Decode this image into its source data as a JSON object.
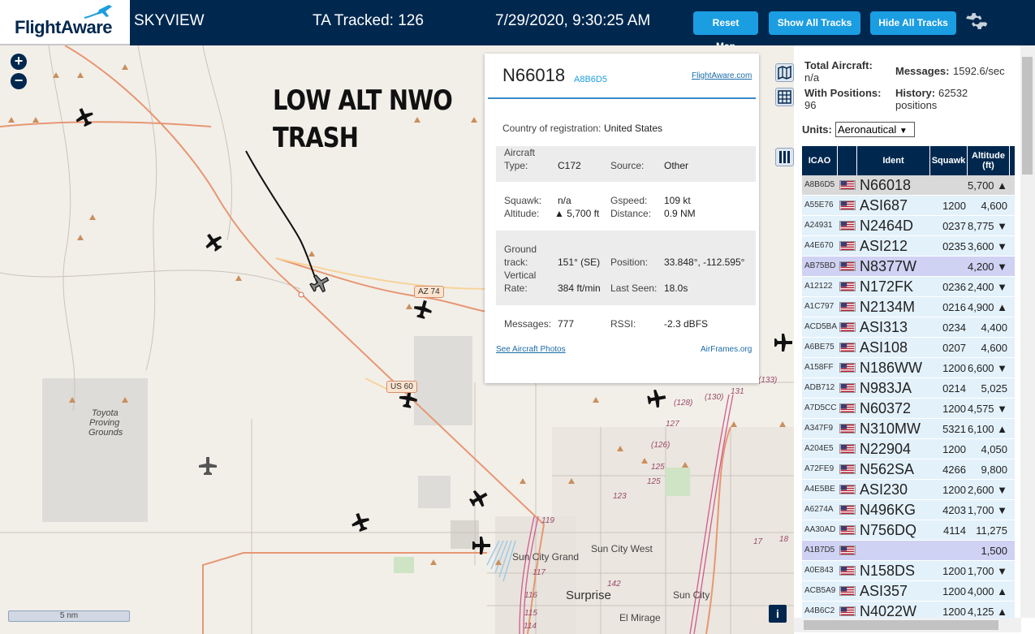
{
  "header": {
    "logo": "FlightAware",
    "title": "SKYVIEW",
    "tracked": "TA Tracked: 126",
    "datetime": "7/29/2020, 9:30:25 AM",
    "reset_label": "Reset Map",
    "show_label": "Show All Tracks",
    "hide_label": "Hide All Tracks",
    "brand_color": "#00284f",
    "button_color": "#1b9de2"
  },
  "map": {
    "zoom_in": "+",
    "zoom_out": "−",
    "annotation_line1": "LOW ALT NWO",
    "annotation_line2": "TRASH",
    "scale": "5 nm",
    "info_btn": "i",
    "labels": [
      {
        "text": "Toyota"
      },
      {
        "text": "Proving"
      },
      {
        "text": "Grounds"
      },
      {
        "text": "Sun City Grand"
      },
      {
        "text": "Sun City West"
      },
      {
        "text": "Surprise"
      },
      {
        "text": "Sun City"
      },
      {
        "text": "El Mirage"
      }
    ],
    "shields": [
      "AZ 74",
      "US 60"
    ],
    "road_numbers": [
      "(128)",
      "(130)",
      "131",
      "127",
      "(126)",
      "125",
      "123",
      "125",
      "119",
      "117",
      "116",
      "115",
      "114",
      "142",
      "(133)",
      "17",
      "18",
      "119"
    ]
  },
  "popup": {
    "ident": "N66018",
    "icao": "A8B6D5",
    "fa_link": "FlightAware.com",
    "country_label": "Country of registration:",
    "country": "United States",
    "type_label_1": "Aircraft",
    "type_label_2": "Type:",
    "type": "C172",
    "source_label": "Source:",
    "source": "Other",
    "squawk_label": "Squawk:",
    "squawk": "n/a",
    "gspeed_label": "Gspeed:",
    "gspeed": "109 kt",
    "altitude_label": "Altitude:",
    "altitude": "▲ 5,700 ft",
    "distance_label": "Distance:",
    "distance": "0.9 NM",
    "track_label_1": "Ground",
    "track_label_2": "track:",
    "track": "151° (SE)",
    "position_label": "Position:",
    "position": "33.848°, -112.595°",
    "vrate_label_1": "Vertical",
    "vrate_label_2": "Rate:",
    "vrate": "384 ft/min",
    "lastseen_label": "Last Seen:",
    "lastseen": "18.0s",
    "messages_label": "Messages:",
    "messages": "777",
    "rssi_label": "RSSI:",
    "rssi": "-2.3 dBFS",
    "photos_link": "See Aircraft Photos",
    "airframes_link": "AirFrames.org"
  },
  "panel": {
    "total_label": "Total Aircraft:",
    "total": "n/a",
    "messages_label": "Messages:",
    "messages": "1592.6/sec",
    "withpos_label": "With Positions:",
    "withpos": "96",
    "history_label": "History:",
    "history_1": "62532",
    "history_2": "positions",
    "units_label": "Units:",
    "units": "Aeronautical",
    "columns": [
      "ICAO",
      "",
      "Ident",
      "Squawk",
      "Altitude\n(ft)"
    ],
    "rows": [
      {
        "icao": "A8B6D5",
        "ident": "N66018",
        "squawk": "",
        "alt": "5,700 ▲",
        "style": "selected"
      },
      {
        "icao": "A55E76",
        "ident": "ASI687",
        "squawk": "1200",
        "alt": "4,600",
        "style": "normal"
      },
      {
        "icao": "A24931",
        "ident": "N2464D",
        "squawk": "0237",
        "alt": "8,775 ▼",
        "style": "normal"
      },
      {
        "icao": "A4E670",
        "ident": "ASI212",
        "squawk": "0235",
        "alt": "3,600 ▼",
        "style": "normal"
      },
      {
        "icao": "AB75BD",
        "ident": "N8377W",
        "squawk": "",
        "alt": "4,200 ▼",
        "style": "mlat"
      },
      {
        "icao": "A12122",
        "ident": "N172FK",
        "squawk": "0236",
        "alt": "2,400 ▼",
        "style": "normal"
      },
      {
        "icao": "A1C797",
        "ident": "N2134M",
        "squawk": "0216",
        "alt": "4,900 ▲",
        "style": "normal"
      },
      {
        "icao": "ACD5BA",
        "ident": "ASI313",
        "squawk": "0234",
        "alt": "4,400",
        "style": "normal"
      },
      {
        "icao": "A6BE75",
        "ident": "ASI108",
        "squawk": "0207",
        "alt": "4,600",
        "style": "normal"
      },
      {
        "icao": "A158FF",
        "ident": "N186WW",
        "squawk": "1200",
        "alt": "6,600 ▼",
        "style": "normal"
      },
      {
        "icao": "ADB712",
        "ident": "N983JA",
        "squawk": "0214",
        "alt": "5,025",
        "style": "normal"
      },
      {
        "icao": "A7D5CC",
        "ident": "N60372",
        "squawk": "1200",
        "alt": "4,575 ▼",
        "style": "normal"
      },
      {
        "icao": "A347F9",
        "ident": "N310MW",
        "squawk": "5321",
        "alt": "6,100 ▲",
        "style": "normal"
      },
      {
        "icao": "A204E5",
        "ident": "N22904",
        "squawk": "1200",
        "alt": "4,050",
        "style": "normal"
      },
      {
        "icao": "A72FE9",
        "ident": "N562SA",
        "squawk": "4266",
        "alt": "9,800",
        "style": "normal"
      },
      {
        "icao": "A4E5BE",
        "ident": "ASI230",
        "squawk": "1200",
        "alt": "2,600 ▼",
        "style": "normal"
      },
      {
        "icao": "A6274A",
        "ident": "N496KG",
        "squawk": "4203",
        "alt": "1,700 ▼",
        "style": "normal"
      },
      {
        "icao": "AA30AD",
        "ident": "N756DQ",
        "squawk": "4114",
        "alt": "11,275",
        "style": "normal"
      },
      {
        "icao": "A1B7D5",
        "ident": "",
        "squawk": "",
        "alt": "1,500",
        "style": "mlat"
      },
      {
        "icao": "A0E843",
        "ident": "N158DS",
        "squawk": "1200",
        "alt": "1,700 ▼",
        "style": "normal"
      },
      {
        "icao": "ACB5A9",
        "ident": "ASI357",
        "squawk": "1200",
        "alt": "4,000 ▲",
        "style": "normal"
      },
      {
        "icao": "A4B6C2",
        "ident": "N4022W",
        "squawk": "1200",
        "alt": "4,125 ▲",
        "style": "normal"
      }
    ]
  }
}
